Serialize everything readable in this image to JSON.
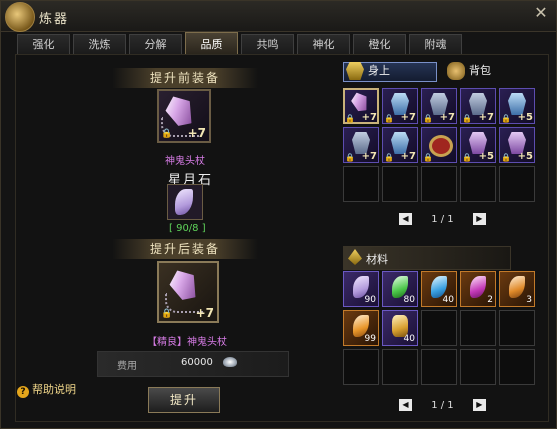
{
  "window": {
    "title": "炼器"
  },
  "tabs": [
    {
      "label": "强化",
      "active": false
    },
    {
      "label": "洗炼",
      "active": false
    },
    {
      "label": "分解",
      "active": false
    },
    {
      "label": "品质",
      "active": true
    },
    {
      "label": "共鸣",
      "active": false
    },
    {
      "label": "神化",
      "active": false
    },
    {
      "label": "橙化",
      "active": false
    },
    {
      "label": "附魂",
      "active": false
    }
  ],
  "left": {
    "before_title": "提升前装备",
    "before_item": {
      "name": "神鬼头杖",
      "level": "+7"
    },
    "stone_label": "星月石",
    "stone_count": "[ 90/8 ]",
    "after_title": "提升后装备",
    "after_item": {
      "name": "【精良】神鬼头杖",
      "level": "+7"
    },
    "fee_label": "费用",
    "fee_value": "60000",
    "help": "帮助说明",
    "upgrade_button": "提升"
  },
  "right": {
    "tab_equipped": "身上",
    "tab_bag": "背包",
    "equip_pager": "1 / 1",
    "materials_title": "材料",
    "materials_pager": "1 / 1",
    "equipment": [
      {
        "icon": "staff-icon",
        "level": "+7"
      },
      {
        "icon": "armor-icon",
        "level": "+7"
      },
      {
        "icon": "helmet-icon",
        "level": "+7"
      },
      {
        "icon": "armor-icon",
        "level": "+7"
      },
      {
        "icon": "robe-icon",
        "level": "+5"
      },
      {
        "icon": "gloves-icon",
        "level": "+7"
      },
      {
        "icon": "boots-icon",
        "level": "+7"
      },
      {
        "icon": "ring-icon",
        "level": ""
      },
      {
        "icon": "necklace-icon",
        "level": "+5"
      },
      {
        "icon": "amulet-icon",
        "level": "+5"
      }
    ],
    "materials": [
      {
        "icon": "purple-stone-icon",
        "qty": "90",
        "color": "#b39bdc"
      },
      {
        "icon": "green-stone-icon",
        "qty": "80",
        "color": "#4cc74a"
      },
      {
        "icon": "blue-stone-icon",
        "qty": "40",
        "color": "#3aa0e0"
      },
      {
        "icon": "magenta-stone-icon",
        "qty": "2",
        "color": "#c43ab8"
      },
      {
        "icon": "orange-stone-icon",
        "qty": "3",
        "color": "#e08a2a"
      },
      {
        "icon": "orange-crystal-icon",
        "qty": "99",
        "color": "#e8962a"
      },
      {
        "icon": "gold-ore-icon",
        "qty": "40",
        "color": "#d8a030"
      }
    ]
  }
}
